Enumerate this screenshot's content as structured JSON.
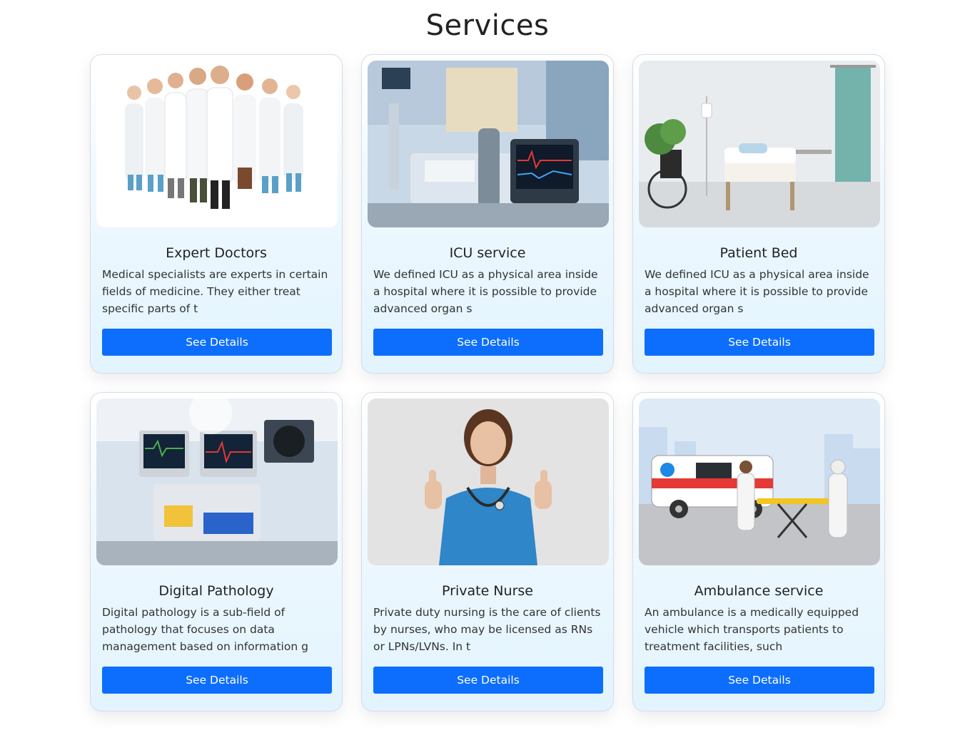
{
  "page": {
    "title": "Services"
  },
  "services": [
    {
      "title": "Expert Doctors",
      "description": "Medical specialists are experts in certain fields of medicine. They either treat specific parts of t",
      "button_label": "See Details"
    },
    {
      "title": "ICU service",
      "description": "We defined ICU as a physical area inside a hospital where it is possible to provide advanced organ s",
      "button_label": "See Details"
    },
    {
      "title": "Patient Bed",
      "description": "We defined ICU as a physical area inside a hospital where it is possible to provide advanced organ s",
      "button_label": "See Details"
    },
    {
      "title": "Digital Pathology",
      "description": "Digital pathology is a sub-field of pathology that focuses on data management based on information g",
      "button_label": "See Details"
    },
    {
      "title": "Private Nurse",
      "description": "Private duty nursing is the care of clients by nurses, who may be licensed as RNs or LPNs/LVNs. In t",
      "button_label": "See Details"
    },
    {
      "title": "Ambulance service",
      "description": "An ambulance is a medically equipped vehicle which transports patients to treatment facilities, such",
      "button_label": "See Details"
    }
  ],
  "colors": {
    "button": "#0d6efd",
    "card_tint": "#e2f4fd",
    "title_text": "#222222"
  }
}
